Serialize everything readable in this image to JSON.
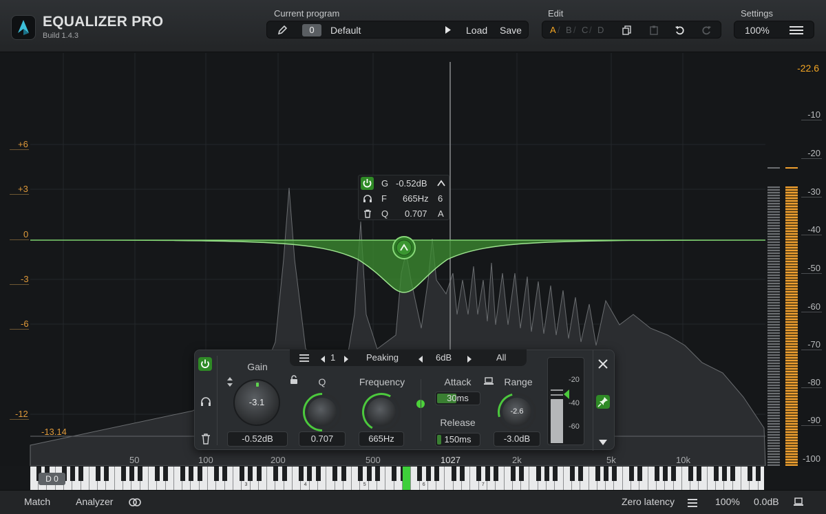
{
  "app": {
    "title": "EQUALIZER PRO",
    "build": "Build 1.4.3"
  },
  "header": {
    "program_label": "Current program",
    "program_number": "0",
    "program_name": "Default",
    "load": "Load",
    "save": "Save",
    "edit_label": "Edit",
    "edit_slots": [
      "A",
      "B",
      "C",
      "D"
    ],
    "settings_label": "Settings",
    "zoom": "100%"
  },
  "graph": {
    "left_db_labels": [
      "+6",
      "+3",
      "0",
      "-3",
      "-6",
      "-12"
    ],
    "right_db_labels": [
      "-10",
      "-20",
      "-30",
      "-40",
      "-50",
      "-60",
      "-70",
      "-80",
      "-90",
      "-100"
    ],
    "peak_value": "-22.6",
    "low_value": "-13.14",
    "freq_labels": [
      "50",
      "100",
      "200",
      "500",
      "1027",
      "2k",
      "5k",
      "10k"
    ],
    "highlight_freq": "1027"
  },
  "band_tooltip": {
    "g_label": "G",
    "g_value": "-0.52dB",
    "f_label": "F",
    "f_value": "665Hz",
    "f_extra": "6",
    "q_label": "Q",
    "q_value": "0.707",
    "q_extra": "A"
  },
  "band_panel": {
    "band_number": "1",
    "filter_type": "Peaking",
    "slope": "6dB",
    "channel": "All",
    "gain_label": "Gain",
    "gain_knob": "-3.1",
    "gain_value": "-0.52dB",
    "q_label": "Q",
    "q_value": "0.707",
    "freq_label": "Frequency",
    "freq_value": "665Hz",
    "attack_label": "Attack",
    "attack_value": "30ms",
    "release_label": "Release",
    "release_value": "150ms",
    "range_label": "Range",
    "range_knob": "-2.6",
    "range_value": "-3.0dB",
    "mini_meter_labels": [
      "-20",
      "-40",
      "-60"
    ]
  },
  "piano": {
    "note_badge": "D 0",
    "octaves": [
      "3",
      "4",
      "5",
      "6",
      "7"
    ]
  },
  "footer": {
    "match": "Match",
    "analyzer": "Analyzer",
    "latency": "Zero latency",
    "zoom": "100%",
    "output_gain": "0.0dB"
  },
  "colors": {
    "accent_green": "#4cc93d",
    "accent_orange": "#f5a623",
    "bg": "#151719"
  }
}
